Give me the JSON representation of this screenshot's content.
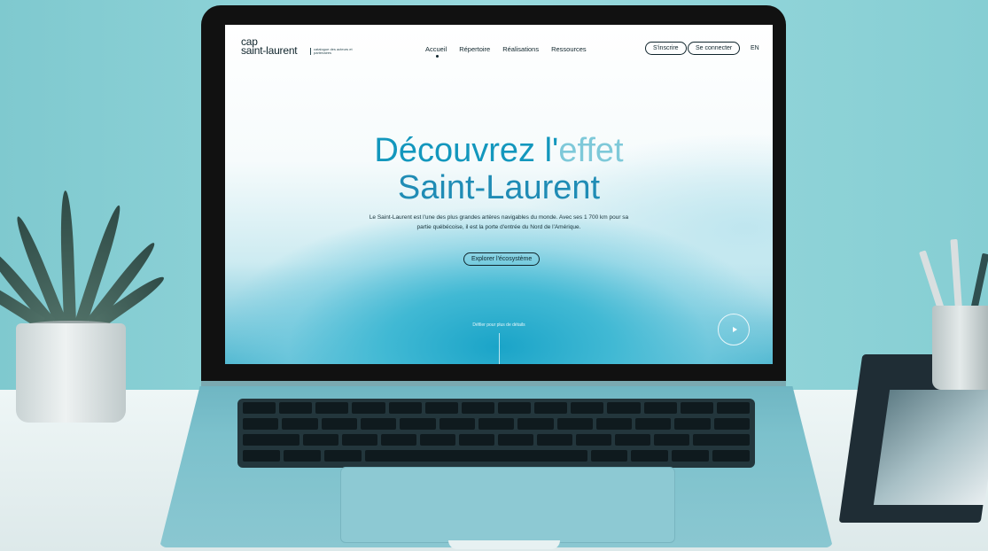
{
  "site": {
    "logo": {
      "line1": "cap",
      "line2": "saint-laurent",
      "tagline": "catalogue des acteurs et partenaires"
    },
    "nav": [
      "Accueil",
      "Répertoire",
      "Réalisations",
      "Ressources"
    ],
    "active_nav": "Accueil",
    "signup_label": "S'inscrire",
    "login_label": "Se connecter",
    "lang_label": "EN",
    "hero": {
      "title_line1_a": "Découvrez l'",
      "title_line1_b": "effet",
      "title_line2": "Saint-Laurent",
      "description": "Le Saint-Laurent est l'une des plus grandes artères navigables du monde. Avec ses 1 700 km pour sa partie québécoise, il est la porte d'entrée du Nord de l'Amérique.",
      "cta_label": "Explorer l'écosystème",
      "scroll_hint": "Défiler pour plus de détails"
    }
  },
  "colors": {
    "accent": "#1397bd",
    "text": "#10252c",
    "wall": "#9adade"
  },
  "icons": {
    "play": "play-icon"
  }
}
